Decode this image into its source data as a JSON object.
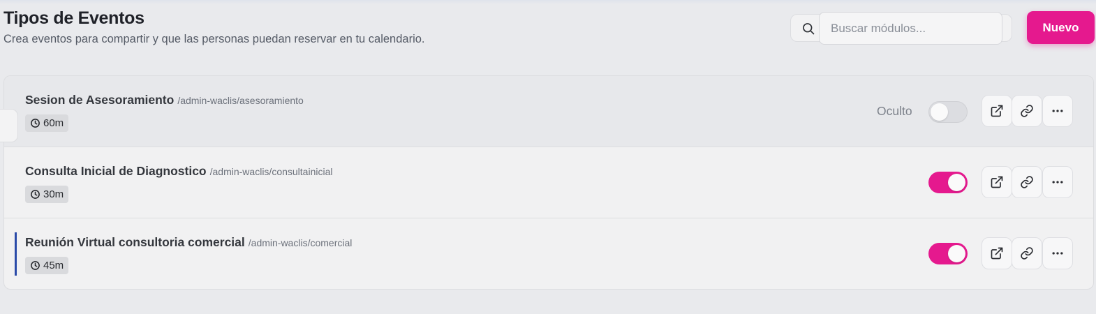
{
  "header": {
    "title": "Tipos de Eventos",
    "subtitle": "Crea eventos para compartir y que las personas puedan reservar en tu calendario."
  },
  "search": {
    "placeholder": "Buscar módulos...",
    "value": ""
  },
  "toolbar": {
    "new_label": "Nuevo"
  },
  "colors": {
    "accent": "#e5198e",
    "row_marker": "#2a4aa8"
  },
  "events": [
    {
      "title": "Sesion de Asesoramiento",
      "slug": "/admin-waclis/asesoramiento",
      "duration": "60m",
      "status_label": "Oculto",
      "enabled": false
    },
    {
      "title": "Consulta Inicial de Diagnostico",
      "slug": "/admin-waclis/consultainicial",
      "duration": "30m",
      "enabled": true
    },
    {
      "title": "Reunión Virtual consultoria comercial",
      "slug": "/admin-waclis/comercial",
      "duration": "45m",
      "enabled": true
    }
  ],
  "icons": {
    "search": "search-icon",
    "clock": "clock-icon",
    "open": "external-link-icon",
    "link": "link-icon",
    "more": "more-horizontal-icon"
  }
}
